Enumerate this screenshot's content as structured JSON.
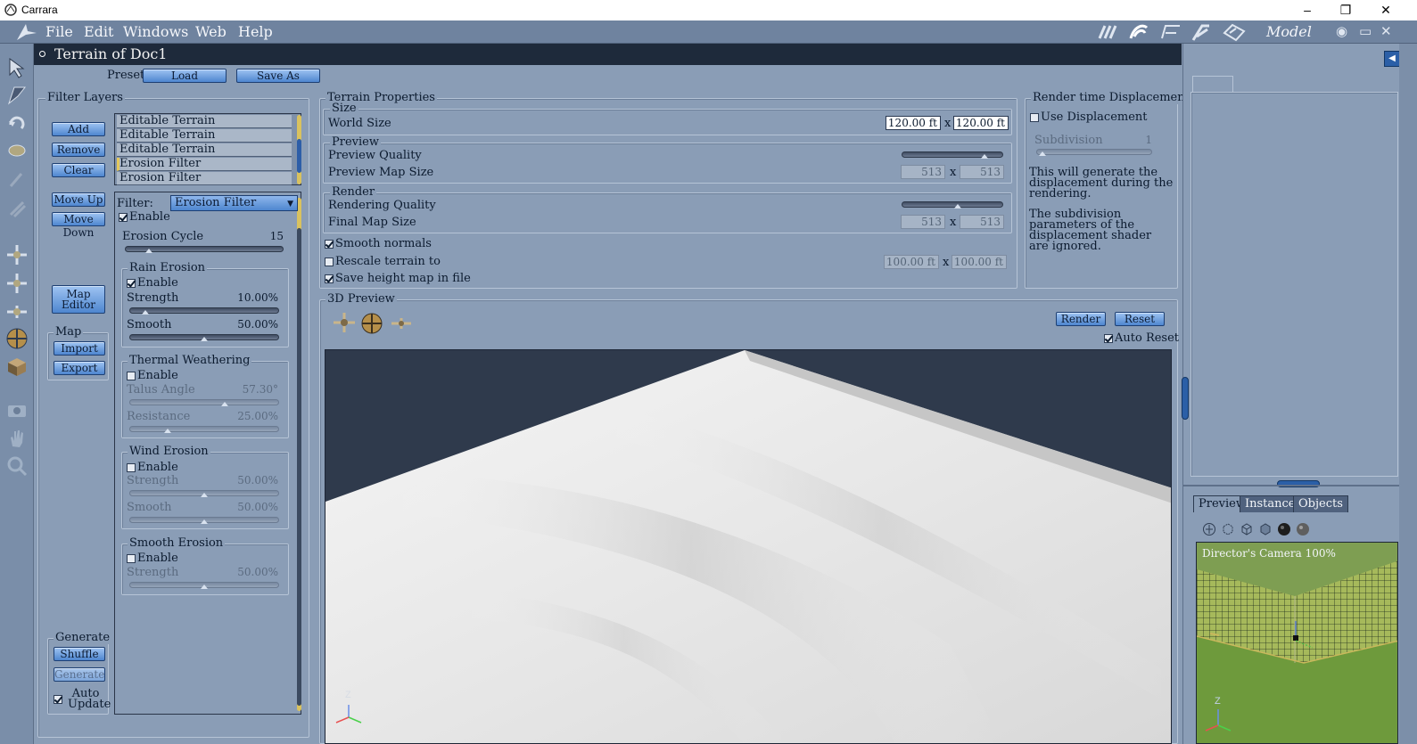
{
  "os_window": {
    "title": "Carrara",
    "buttons": {
      "minimize": "–",
      "maximize": "❐",
      "close": "✕"
    }
  },
  "menu": {
    "items": [
      "File",
      "Edit",
      "Windows",
      "Web",
      "Help"
    ],
    "room": "Model",
    "right_icons": {
      "eye": "◉",
      "window": "▭",
      "close": "✕"
    }
  },
  "doc": {
    "title": "Terrain of Doc1",
    "preset_label": "Preset:",
    "load_label": "Load",
    "save_as_label": "Save As"
  },
  "filter_layers": {
    "title": "Filter Layers",
    "buttons": {
      "add": "Add",
      "remove": "Remove",
      "clear": "Clear",
      "move_up": "Move Up",
      "move_down": "Move Down",
      "map_editor": "Map\nEditor"
    },
    "layers": [
      "Editable Terrain",
      "Editable Terrain",
      "Editable Terrain",
      "Erosion Filter",
      "Erosion Filter"
    ],
    "selected_index": 3,
    "map_group": {
      "title": "Map",
      "import": "Import",
      "export": "Export"
    },
    "generate_group": {
      "title": "Generate",
      "shuffle": "Shuffle",
      "generate": "Generate",
      "auto_update": "Auto\nUpdate"
    }
  },
  "filter_settings": {
    "filter_label": "Filter:",
    "filter_value": "Erosion Filter",
    "enable_label": "Enable",
    "erosion_cycle_label": "Erosion Cycle",
    "erosion_cycle_value": "15",
    "erosion_cycle_fraction": 0.15,
    "rain": {
      "title": "Rain Erosion",
      "enable": "Enable",
      "strength_label": "Strength",
      "strength_value": "10.00%",
      "strength_fraction": 0.1,
      "smooth_label": "Smooth",
      "smooth_value": "50.00%",
      "smooth_fraction": 0.5
    },
    "thermal": {
      "title": "Thermal Weathering",
      "enable": "Enable",
      "talus_label": "Talus Angle",
      "talus_value": "57.30°",
      "talus_fraction": 0.64,
      "resistance_label": "Resistance",
      "resistance_value": "25.00%",
      "resistance_fraction": 0.25
    },
    "wind": {
      "title": "Wind Erosion",
      "enable": "Enable",
      "strength_label": "Strength",
      "strength_value": "50.00%",
      "strength_fraction": 0.5,
      "smooth_label": "Smooth",
      "smooth_value": "50.00%",
      "smooth_fraction": 0.5
    },
    "smooth": {
      "title": "Smooth Erosion",
      "enable": "Enable",
      "strength_label": "Strength",
      "strength_value": "50.00%",
      "strength_fraction": 0.5
    }
  },
  "terrain_properties": {
    "title": "Terrain Properties",
    "size_title": "Size",
    "world_size_label": "World Size",
    "world_w": "120.00 ft",
    "world_h": "120.00 ft",
    "x_sep": "x",
    "preview_title": "Preview",
    "preview_quality_label": "Preview Quality",
    "preview_quality_fraction": 0.82,
    "preview_map_label": "Preview Map Size",
    "preview_map_w": "513",
    "preview_map_h": "513",
    "render_title": "Render",
    "render_quality_label": "Rendering Quality",
    "render_quality_fraction": 0.55,
    "final_map_label": "Final Map Size",
    "final_map_w": "513",
    "final_map_h": "513",
    "smooth_normals": "Smooth normals",
    "rescale_label": "Rescale terrain to",
    "rescale_w": "100.00 ft",
    "rescale_h": "100.00 ft",
    "save_height": "Save height map in file"
  },
  "render_displacement": {
    "title": "Render time Displacement",
    "use_label": "Use Displacement",
    "subdivision_label": "Subdivision",
    "subdivision_value": "1",
    "note1": "This will generate the displacement during the rendering.",
    "note2": "The subdivision parameters of the displacement shader are ignored."
  },
  "preview3d": {
    "title": "3D Preview",
    "render": "Render",
    "reset": "Reset",
    "auto_reset": "Auto Reset",
    "axis_z": "Z"
  },
  "right_panel": {
    "tabs": [
      "Preview",
      "Instances",
      "Objects"
    ],
    "camera_label": "Director's Camera 100%",
    "axis_z": "Z"
  }
}
